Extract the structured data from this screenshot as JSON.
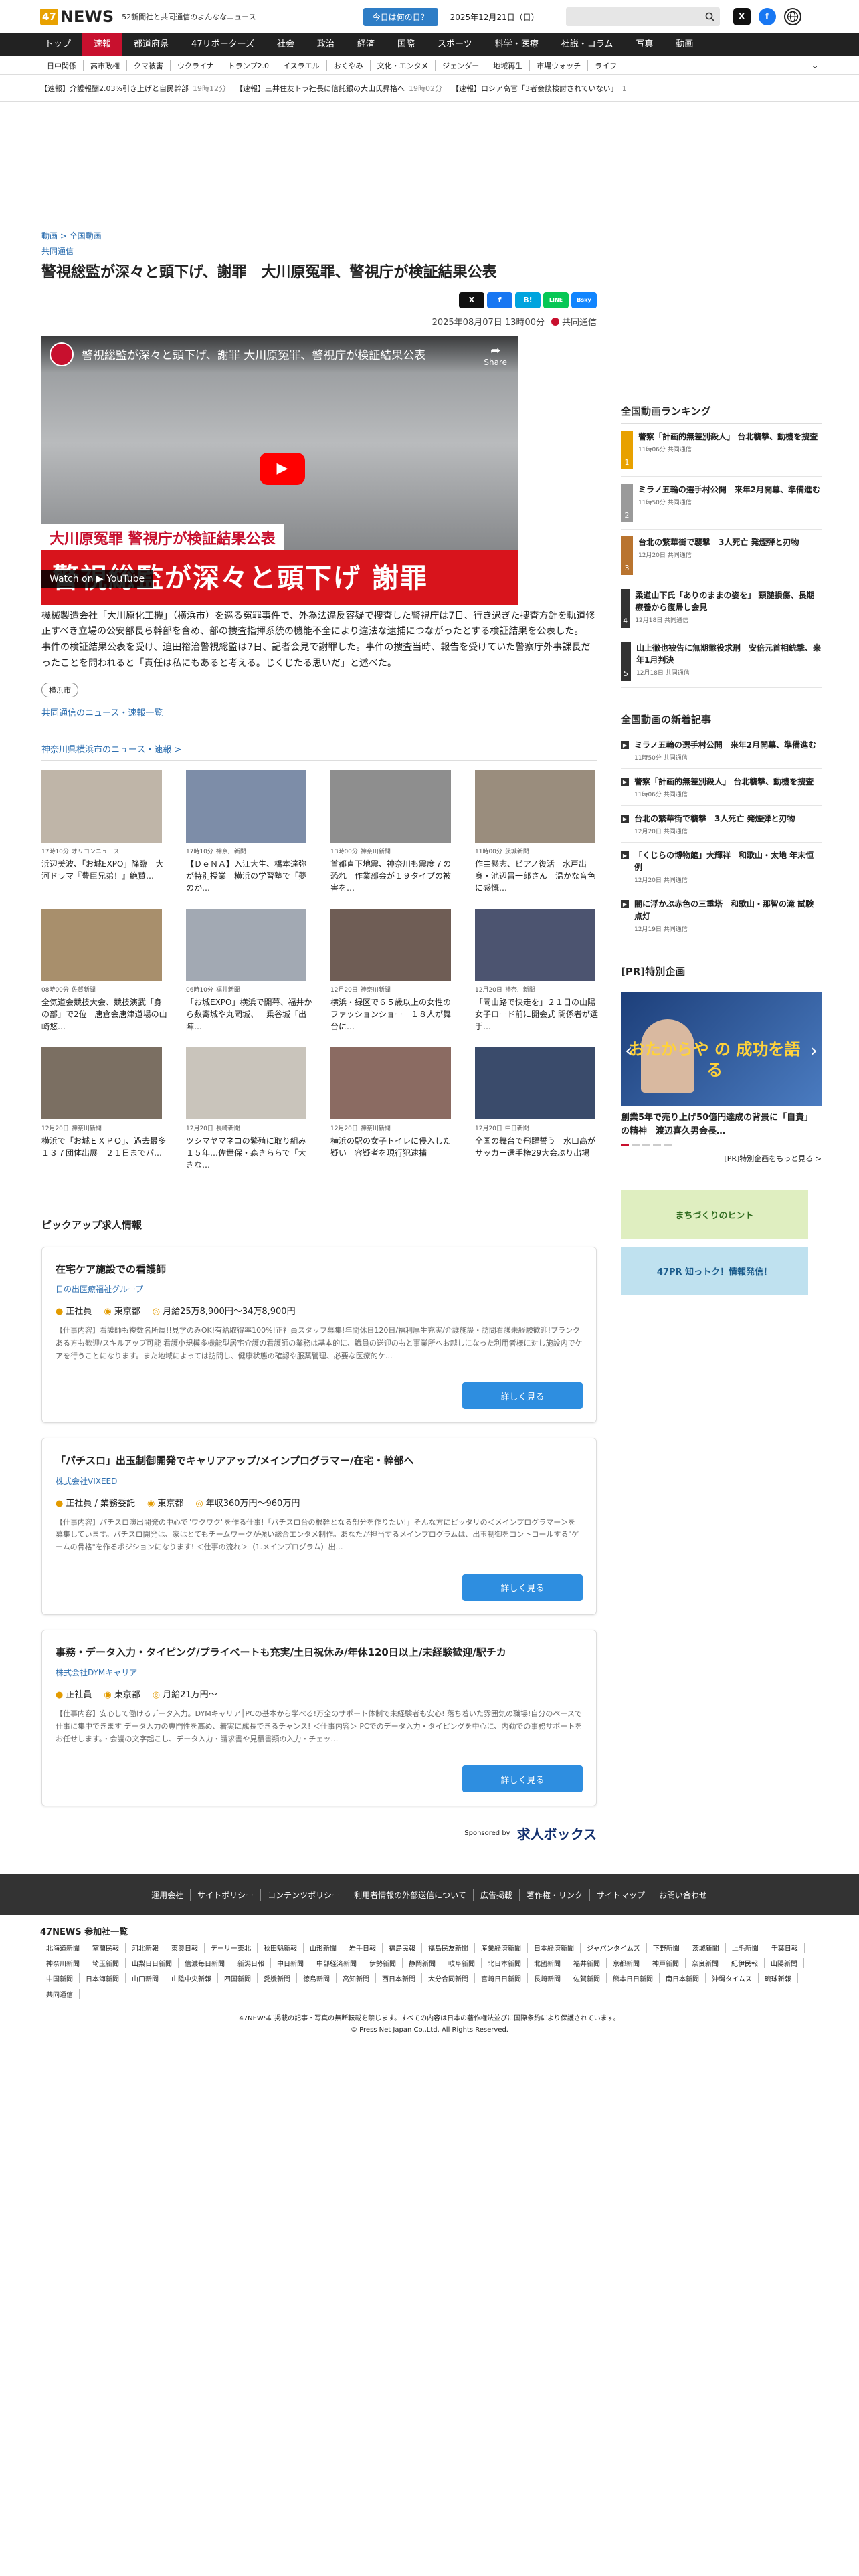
{
  "header": {
    "logo_num": "47",
    "logo_text": "NEWS",
    "tagline": "52新聞社と共同通信のよんななニュース",
    "today_button": "今日は何の日？",
    "date": "2025年12月21日（日）",
    "search_icon": "search-icon",
    "x_label": "X",
    "fb_label": "f"
  },
  "main_nav": [
    "トップ",
    "速報",
    "都道府県",
    "47リポーターズ",
    "社会",
    "政治",
    "経済",
    "国際",
    "スポーツ",
    "科学・医療",
    "社説・コラム",
    "写真",
    "動画"
  ],
  "sub_nav": [
    "日中関係",
    "高市政権",
    "クマ被害",
    "ウクライナ",
    "トランプ2.0",
    "イスラエル",
    "おくやみ",
    "文化・エンタメ",
    "ジェンダー",
    "地域再生",
    "市場ウォッチ",
    "ライフ"
  ],
  "ticker": [
    {
      "text": "【速報】介護報酬2.03%引き上げと自民幹部",
      "time": "19時12分"
    },
    {
      "text": "【速報】三井住友トラ社長に信託銀の大山氏昇格へ",
      "time": "19時02分"
    },
    {
      "text": "【速報】ロシア高官「3者会談検討されていない」",
      "time": "1"
    }
  ],
  "article": {
    "breadcrumb": "動画 > 全国動画",
    "source": "共同通信",
    "title": "警視総監が深々と頭下げ、謝罪　大川原冤罪、警視庁が検証結果公表",
    "share": [
      "X",
      "f",
      "B!",
      "LINE",
      "Bsky"
    ],
    "datetime": "2025年08月07日 13時00分",
    "publisher": "共同通信",
    "video_title": "警視総監が深々と頭下げ、謝罪 大川原冤罪、警視庁が検証結果公表",
    "video_share": "Share",
    "banner_small": "大川原冤罪 警視庁が検証結果公表",
    "banner_big": "警視総監が深々と頭下げ 謝罪",
    "watch_on": "Watch on  ▶ YouTube",
    "paragraph1": "機械製造会社「大川原化工機」（横浜市）を巡る冤罪事件で、外為法違反容疑で捜査した警視庁は7日、行き過ぎた捜査方針を軌道修正すべき立場の公安部長ら幹部を含め、部の捜査指揮系統の機能不全により違法な逮捕につながったとする検証結果を公表した。",
    "paragraph2": "事件の検証結果公表を受け、迫田裕治警視総監は7日、記者会見で謝罪した。事件の捜査当時、報告を受けていた警察庁外事課長だったことを問われると「責任は私にもあると考える。じくじたる思いだ」と述べた。",
    "tag": "横浜市",
    "more": "共同通信のニュース・速報一覧"
  },
  "local_news": {
    "heading": "神奈川県横浜市のニュース・速報 >",
    "items": [
      {
        "time": "17時10分",
        "source": "オリコンニュース",
        "title": "浜辺美波、「お城EXPO」降臨　大河ドラマ『豊臣兄弟！』絶賛…"
      },
      {
        "time": "17時10分",
        "source": "神奈川新聞",
        "title": "【ＤｅＮＡ】入江大生、橋本達弥が特別授業　横浜の学習塾で「夢のか…"
      },
      {
        "time": "13時00分",
        "source": "神奈川新聞",
        "title": "首都直下地震、神奈川も震度７の恐れ　作業部会が１９タイプの被害を…"
      },
      {
        "time": "11時00分",
        "source": "茨城新聞",
        "title": "作曲懸志、ピアノ復活　水戸出身・池辺晋一郎さん　温かな音色に感慨…"
      },
      {
        "time": "08時00分",
        "source": "佐賀新聞",
        "title": "全気道会競技大会、競技演武「身の部」で2位　唐倉会唐津道場の山崎悠…"
      },
      {
        "time": "06時10分",
        "source": "福井新聞",
        "title": "「お城EXPO」横浜で開幕、福井から数寄城や丸岡城、一乗谷城「出陣…"
      },
      {
        "time": "12月20日",
        "source": "神奈川新聞",
        "title": "横浜・緑区で６５歳以上の女性のファッションショー　１８人が舞台に…"
      },
      {
        "time": "12月20日",
        "source": "神奈川新聞",
        "title": "「岡山路で快走を」２１日の山陽女子ロード前に開会式 関係者が選手…"
      },
      {
        "time": "12月20日",
        "source": "神奈川新聞",
        "title": "横浜で「お城ＥＸＰＯ」、過去最多１３７団体出展　２１日までパ…"
      },
      {
        "time": "12月20日",
        "source": "長崎新聞",
        "title": "ツシマヤマネコの繁殖に取り組み１５年…佐世保・森きららで「大きな…"
      },
      {
        "time": "12月20日",
        "source": "神奈川新聞",
        "title": "横浜の駅の女子トイレに侵入した疑い　容疑者を現行犯逮捕"
      },
      {
        "time": "12月20日",
        "source": "中日新聞",
        "title": "全国の舞台で飛躍誓う　水口高がサッカー選手権29大会ぶり出場"
      }
    ]
  },
  "jobs": {
    "heading": "ピックアップ求人情報",
    "items": [
      {
        "title": "在宅ケア施設での看護師",
        "company": "日の出医療福祉グループ",
        "type": "正社員",
        "place": "東京都",
        "pay": "月給25万8,900円〜34万8,900円",
        "desc": "【仕事内容】看護師も複数名所属!!見学のみOK!有給取得率100%!正社員スタッフ募集!年間休日120日/福利厚生充実/介護施設・訪問看護未経験歓迎!ブランクある方も歓迎/スキルアップ可能 看護小規模多機能型居宅介護の看護師の業務は基本的に、職員の送迎のもと事業所へお越しになった利用者様に対し施設内でケアを行うことになります。また地域によっては訪問し、健康状態の確認や服薬管理、必要な医療的ケ…",
        "button": "詳しく見る"
      },
      {
        "title": "「パチスロ」出玉制御開発でキャリアアップ/メインプログラマー/在宅・幹部へ",
        "company": "株式会社VIXEED",
        "type": "正社員 / 業務委託",
        "place": "東京都",
        "pay": "年収360万円〜960万円",
        "desc": "【仕事内容】パチスロ演出開発の中心で\"ワクワク\"を作る仕事!「パチスロ台の根幹となる部分を作りたい!」そんな方にピッタリの＜メインプログラマー＞を募集しています。パチスロ開発は、家はとてもチームワークが強い総合エンタメ制作。あなたが担当するメインプログラムは、出玉制御をコントロールする\"ゲームの骨格\"を作るポジションになります! ＜仕事の流れ＞（1.メインプログラム）出…",
        "button": "詳しく見る"
      },
      {
        "title": "事務・データ入力・タイピング/プライベートも充実/土日祝休み/年休120日以上/未経験歓迎/駅チカ",
        "company": "株式会社DYMキャリア",
        "type": "正社員",
        "place": "東京都",
        "pay": "月給21万円〜",
        "desc": "【仕事内容】安心して働けるデータ入力。DYMキャリア│PCの基本から学べる!万全のサポート体制で未経験者も安心! 落ち着いた雰囲気の職場!自分のペースで仕事に集中できます データ入力の専門性を高め、着実に成長できるチャンス! ＜仕事内容＞ PCでのデータ入力・タイピングを中心に、内勤での事務サポートをお任せします。・会議の文字起こし、データ入力・請求書や見積書類の入力・チェッ…",
        "button": "詳しく見る"
      }
    ],
    "sponsored_by": "Sponsored by",
    "sponsor_name": "求人ボックス"
  },
  "ranking": {
    "heading": "全国動画ランキング",
    "items": [
      {
        "title": "警察「計画的無差別殺人」 台北襲撃、動機を捜査",
        "time": "11時06分",
        "source": "共同通信"
      },
      {
        "title": "ミラノ五輪の選手村公開　来年2月開幕、準備進む",
        "time": "11時50分",
        "source": "共同通信"
      },
      {
        "title": "台北の繁華街で襲撃　3人死亡 発煙弾と刃物",
        "time": "12月20日",
        "source": "共同通信"
      },
      {
        "title": "柔道山下氏「ありのままの姿を」 頸髄損傷、長期療養から復帰し会見",
        "time": "12月18日",
        "source": "共同通信"
      },
      {
        "title": "山上徹也被告に無期懲役求刑　安倍元首相銃撃、来年1月判決",
        "time": "12月18日",
        "source": "共同通信"
      }
    ]
  },
  "new_videos": {
    "heading": "全国動画の新着記事",
    "items": [
      {
        "title": "ミラノ五輪の選手村公開　来年2月開幕、準備進む",
        "time": "11時50分",
        "source": "共同通信"
      },
      {
        "title": "警察「計画的無差別殺人」 台北襲撃、動機を捜査",
        "time": "11時06分",
        "source": "共同通信"
      },
      {
        "title": "台北の繁華街で襲撃　3人死亡 発煙弾と刃物",
        "time": "12月20日",
        "source": "共同通信"
      },
      {
        "title": "「くじらの博物館」大輝祥　和歌山・太地 年末恒例",
        "time": "12月20日",
        "source": "共同通信"
      },
      {
        "title": "闇に浮かぶ赤色の三重塔　和歌山・那智の滝 試験点灯",
        "time": "12月19日",
        "source": "共同通信"
      }
    ]
  },
  "pr": {
    "heading": "[PR]特別企画",
    "img_text": "おたからや の 成功を語る",
    "title": "創業5年で売り上げ50億円達成の背景に「自責」の精神　渡辺喜久男会長…",
    "more": "[PR]特別企画をもっと見る >",
    "banner1": "まちづくりのヒント",
    "banner2": "47PR 知っトク！情報発信！"
  },
  "footer": {
    "links": [
      "運用会社",
      "サイトポリシー",
      "コンテンツポリシー",
      "利用者情報の外部送信について",
      "広告掲載",
      "著作権・リンク",
      "サイトマップ",
      "お問い合わせ"
    ],
    "members_heading": "47NEWS 参加社一覧",
    "members": [
      "北海道新聞",
      "室蘭民報",
      "河北新報",
      "東奥日報",
      "デーリー東北",
      "秋田魁新報",
      "山形新聞",
      "岩手日報",
      "福島民報",
      "福島民友新聞",
      "産業経済新聞",
      "日本経済新聞",
      "ジャパンタイムズ",
      "下野新聞",
      "茨城新聞",
      "上毛新聞",
      "千葉日報",
      "神奈川新聞",
      "埼玉新聞",
      "山梨日日新聞",
      "信濃毎日新聞",
      "新潟日報",
      "中日新聞",
      "中部経済新聞",
      "伊勢新聞",
      "静岡新聞",
      "岐阜新聞",
      "北日本新聞",
      "北國新聞",
      "福井新聞",
      "京都新聞",
      "神戸新聞",
      "奈良新聞",
      "紀伊民報",
      "山陽新聞",
      "中国新聞",
      "日本海新聞",
      "山口新聞",
      "山陰中央新報",
      "四国新聞",
      "愛媛新聞",
      "徳島新聞",
      "高知新聞",
      "西日本新聞",
      "大分合同新聞",
      "宮崎日日新聞",
      "長崎新聞",
      "佐賀新聞",
      "熊本日日新聞",
      "南日本新聞",
      "沖縄タイムス",
      "琉球新報",
      "共同通信"
    ],
    "note": "47NEWSに掲載の記事・写真の無断転載を禁じます。すべての内容は日本の著作権法並びに国際条約により保護されています。",
    "copyright": "© Press Net Japan Co.,Ltd. All Rights Reserved."
  },
  "colors": {
    "brand": "#e8a100",
    "accent": "#c8102e",
    "link": "#2e6fb0",
    "button": "#2e8ee0"
  }
}
